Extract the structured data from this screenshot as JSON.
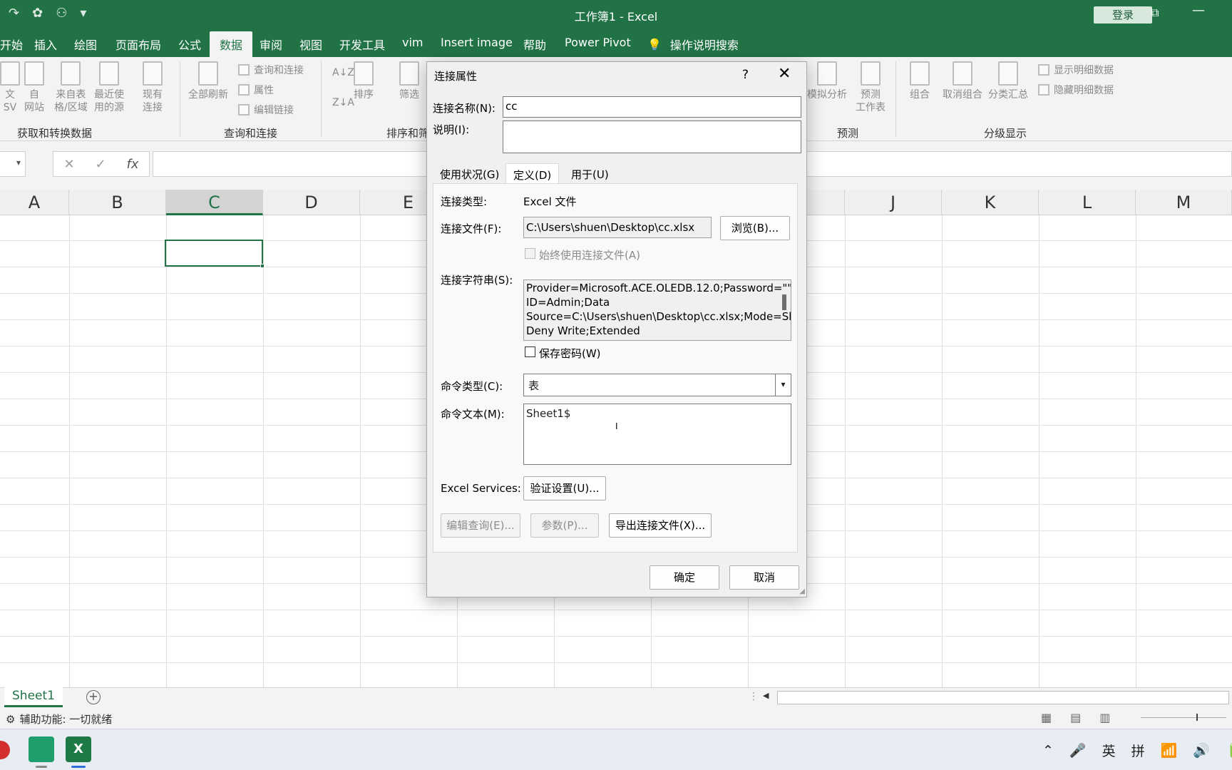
{
  "titlebar": {
    "title": "工作簿1  -  Excel",
    "login": "登录"
  },
  "menu": {
    "tabs": [
      "开始",
      "插入",
      "绘图",
      "页面布局",
      "公式",
      "数据",
      "审阅",
      "视图",
      "开发工具",
      "vim",
      "Insert image",
      "帮助",
      "Power Pivot"
    ],
    "active_tab": "数据",
    "search": "操作说明搜索"
  },
  "ribbon": {
    "items": [
      "文\nSV",
      "自\n网站",
      "来自表\n格/区域",
      "最近使\n用的源",
      "现有\n连接",
      "全部刷新",
      "排序",
      "筛选",
      "模拟分析",
      "预测\n工作表",
      "组合",
      "取消组合",
      "分类汇总"
    ],
    "small_items": [
      "查询和连接",
      "属性",
      "编辑链接",
      "显示明细数据",
      "隐藏明细数据"
    ],
    "groups": [
      "获取和转换数据",
      "查询和连接",
      "排序和筛",
      "预测",
      "分级显示"
    ]
  },
  "columns": [
    "A",
    "B",
    "C",
    "D",
    "E",
    "J",
    "K",
    "L",
    "M"
  ],
  "selected_column": "C",
  "sheet": {
    "tab": "Sheet1"
  },
  "status": {
    "accessibility": "辅助功能: 一切就绪"
  },
  "taskbar": {
    "tray": [
      "英",
      "拼"
    ]
  },
  "dialog": {
    "title": "连接属性",
    "help": "?",
    "close": "✕",
    "name_label": "连接名称(N):",
    "name_value": "cc",
    "desc_label": "说明(I):",
    "desc_value": "",
    "tabs": [
      "使用状况(G)",
      "定义(D)",
      "用于(U)"
    ],
    "active_tab": "定义(D)",
    "conn_type_label": "连接类型:",
    "conn_type_value": "Excel 文件",
    "conn_file_label": "连接文件(F):",
    "conn_file_value": "C:\\Users\\shuen\\Desktop\\cc.xlsx",
    "browse": "浏览(B)...",
    "always_use": "始终使用连接文件(A)",
    "conn_string_label": "连接字符串(S):",
    "conn_string": "Provider=Microsoft.ACE.OLEDB.12.0;Password=\"\";User ID=Admin;Data Source=C:\\Users\\shuen\\Desktop\\cc.xlsx;Mode=Share Deny Write;Extended Properties=\"HDR=YES;\";Jet",
    "save_password": "保存密码(W)",
    "cmd_type_label": "命令类型(C):",
    "cmd_type_value": "表",
    "cmd_text_label": "命令文本(M):",
    "cmd_text_value": "Sheet1$",
    "excel_services_label": "Excel Services:",
    "auth_settings": "验证设置(U)...",
    "edit_query": "编辑查询(E)...",
    "params": "参数(P)...",
    "export_conn": "导出连接文件(X)...",
    "ok": "确定",
    "cancel": "取消"
  }
}
